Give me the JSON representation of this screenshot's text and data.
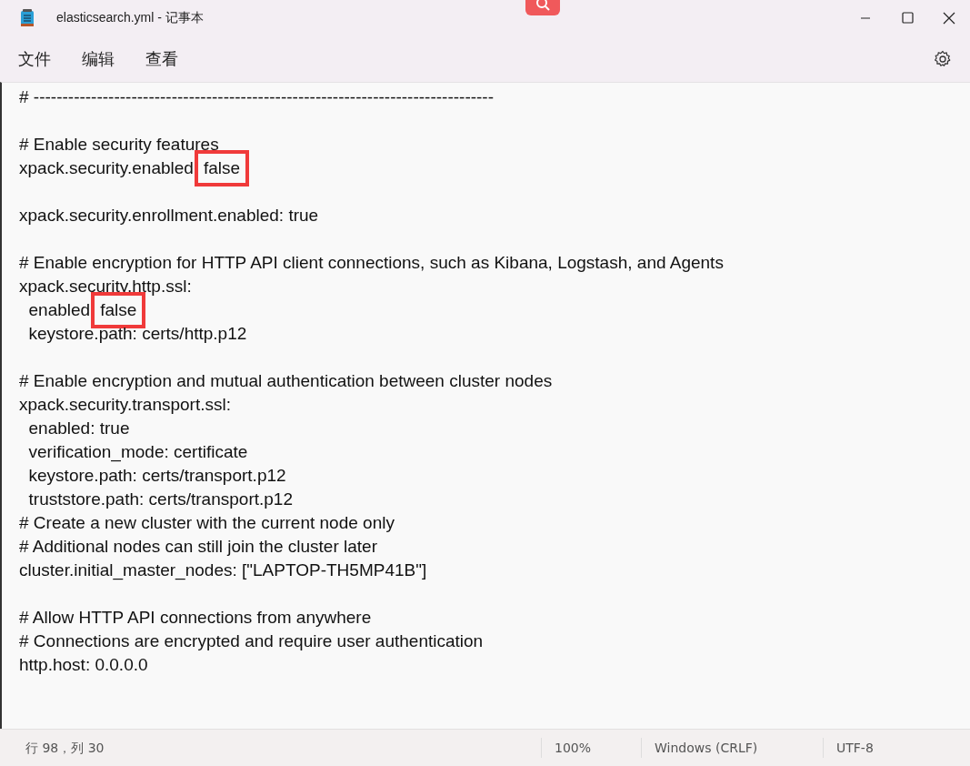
{
  "window": {
    "title": "elasticsearch.yml - 记事本"
  },
  "menu": [
    {
      "label": "文件"
    },
    {
      "label": "编辑"
    },
    {
      "label": "查看"
    }
  ],
  "editor": {
    "blocks": [
      [
        {
          "text": "# --------------------------------------------------------------------------------"
        }
      ],
      [
        {
          "text": "# Enable security features"
        },
        {
          "text": "xpack.security.enabled",
          "marked": "false"
        }
      ],
      [
        {
          "text": "xpack.security.enrollment.enabled: true"
        }
      ],
      [
        {
          "text": "# Enable encryption for HTTP API client connections, such as Kibana, Logstash, and Agents"
        },
        {
          "text": "xpack.security.http.ssl:"
        },
        {
          "text": "  enabled",
          "marked": "false"
        },
        {
          "text": "  keystore.path: certs/http.p12"
        }
      ],
      [
        {
          "text": "# Enable encryption and mutual authentication between cluster nodes"
        },
        {
          "text": "xpack.security.transport.ssl:"
        },
        {
          "text": "  enabled: true"
        },
        {
          "text": "  verification_mode: certificate"
        },
        {
          "text": "  keystore.path: certs/transport.p12"
        },
        {
          "text": "  truststore.path: certs/transport.p12"
        },
        {
          "text": "# Create a new cluster with the current node only"
        },
        {
          "text": "# Additional nodes can still join the cluster later"
        },
        {
          "text": "cluster.initial_master_nodes: [\"LAPTOP-TH5MP41B\"]"
        }
      ],
      [
        {
          "text": "# Allow HTTP API connections from anywhere"
        },
        {
          "text": "# Connections are encrypted and require user authentication"
        },
        {
          "text": "http.host: 0.0.0.0"
        }
      ]
    ]
  },
  "status_bar": [
    {
      "text": "行 98，列 30"
    },
    {
      "text": "100%"
    },
    {
      "text": "Windows (CRLF)"
    },
    {
      "text": "UTF-8"
    }
  ]
}
